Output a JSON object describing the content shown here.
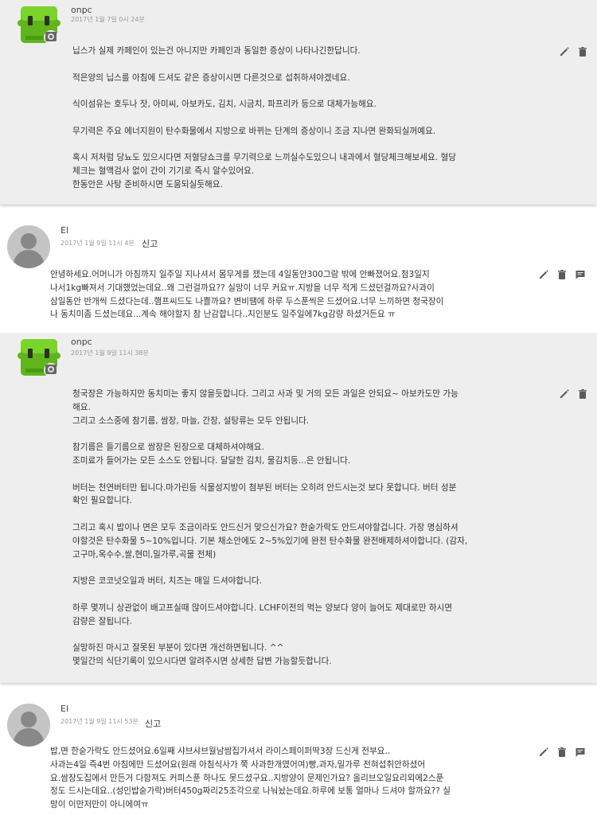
{
  "comments": [
    {
      "author": "onpc",
      "date": "2017년 1월 7일 0시 24분",
      "report": "",
      "body": "닙스가 실제 카페인이 있는건 아니지만 카페인과 동일한 증상이 나타나긴한답니다.\n\n적은양의 닙스를 아침에 드셔도 같은 증상이시면 다른것으로 섭취하셔야겠네요.\n\n식이섬유는 호두나 잣, 아미씨, 아보카도, 김치, 시금치, 파프리카 등으로 대체가능해요.\n\n무기력은 주요 에너지원이 탄수화물에서 지방으로 바뀌는 단계의 증상이니 조금 지나면 완화되실꺼예요.\n\n혹시 저처럼 당뇨도 있으시다면 저혈당쇼크를 무기력으로 느끼실수도있으니 내과에서 혈당체크해보세요. 혈당\n체크는 혈액검사 없이 간이 기기로 즉시 알수있어요.\n한동안은 사탕 준비하시면 도움되실듯해요."
    },
    {
      "author": "El",
      "date": "2017년 1월 9일 11시 4분",
      "report": "신고",
      "body": "안녕하세요.어머니가 아침까지 일주일 지나셔서 몸무게를 쟀는데 4일동안300그람 밖에 안빠졌어요.첨3일지\n나서1kg빠져서 기대했었는데요..왜 그런걸까요?? 실망이 너무 커요ㅠ.지방을 너무 적게 드셨던걸까요?사과이\n삼일동안 반개씩 드셨다는데..햄프씨드도 나쁠까요? 변비땜에 하루 두스푼씩은 드셨어요.너무 느끼하면 청국장이\n나 동치미좀 드셨는데요...계속 해야할지 참 난감합니다..지인분도 일주일에7kg감량 하셨거든요 ㅠ"
    },
    {
      "author": "onpc",
      "date": "2017년 1월 9일 11시 38분",
      "report": "",
      "body": "청국장은 가능하지만 동치미는 좋지 않을듯합니다. 그리고 사과 및 거의 모든 과일은 안되요~ 아보카도만 가능\n해요.\n그리고 소스중에 참기름, 쌈장, 마늘, 간장, 설탕류는 모두 안됩니다.\n\n참기름은 들기름으로 쌈장은 된장으로 대체하셔야해요.\n조미료가 들어가는 모든 소스도 안됩니다. 달달한 김치, 물김치등...은 안됩니다.\n\n버터는 천연버터만 됩니다.마가린등 식물성지방이 첨부된 버터는 오히려 안드시는것 보다 못합니다. 버터 성분\n확인 필요합니다.\n\n그리고 혹시 밥이나 면은 모두 조금이라도 안드신거 맞으신가요? 한숟가락도 안드셔야할겁니다. 가장 명심하셔\n야할것은 탄수화물 5~10%입니다. 기본 채소안에도 2~5%있기에 완전 탄수화물 완전배제하셔야합니다. (감자,\n고구마,옥수수,쌀,현미,밀가루,곡물 전체)\n\n지방은 코코넛오일과 버터, 치즈는 매일 드셔야합니다.\n\n하루 몇끼니 상관없이 배고프실때 많이드셔야합니다. LCHF이전의 먹는 양보다 양이 늘어도 제대로만 하시면\n감량은 잘됩니다.\n\n실망하진 마시고 잘못된 부분이 있다면 개선하면됩니다. ^^\n몇일간의 식단기록이 있으시다면 알려주시면 상세한 답변 가능할듯합니다."
    },
    {
      "author": "El",
      "date": "2017년 1월 9일 11시 53분",
      "report": "신고",
      "body": "밥,면 한숟가락도 안드셨어요.6일째 샤브샤브월남쌈집가셔서 라이스페이퍼딱3장 드신게 전부요..\n사과는4일 즉4번 아침에만 드셨어요(원래 아침식사가 쭉 사과한개였어여)빵,과자,밀가루 전혀섭취안하셨어\n요.쌈장도집에서 만든거 다함져도 커피스푼 하나도 못드셨구요..지방양이 문제인가요? 올리브오일요리외에2스푼\n정도 드시는데요..(성인밥숟가락)버터450g짜리25조각으로 나눠놨는데요.하루에 보통 얼마나 드셔야 할까요?? 실\n망이 이만저만이 아니에여ㅠ"
    }
  ],
  "icons": {
    "edit": "pencil-icon",
    "delete": "trash-icon",
    "reply": "comment-icon"
  },
  "colors": {
    "owner_bg": "#eeeeee",
    "avatar_green": "#6cc51f",
    "icon_gray": "#5a5a5a"
  }
}
